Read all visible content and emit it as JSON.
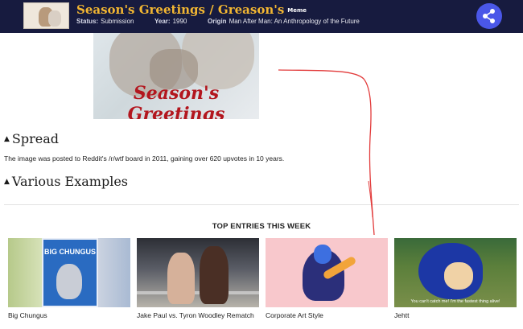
{
  "header": {
    "title": "Season's Greetings / Greason's",
    "badge": "Meme",
    "status_label": "Status:",
    "status_value": "Submission",
    "year_label": "Year:",
    "year_value": "1990",
    "origin_label": "Origin",
    "origin_value": "Man After Man: An Anthropology of the Future",
    "share_icon": "share-icon",
    "colors": {
      "bar": "#171b3f",
      "title": "#f2b632",
      "share": "#4a57e8"
    }
  },
  "hero": {
    "caption": "Season's Greetings"
  },
  "sections": {
    "spread": {
      "heading": "Spread",
      "text": "The image was posted to Reddit's /r/wtf board in 2011, gaining over 620 upvotes in 10 years."
    },
    "examples": {
      "heading": "Various Examples"
    }
  },
  "top_entries": {
    "heading": "TOP ENTRIES THIS WEEK",
    "items": [
      {
        "caption": "Big Chungus",
        "image_text": "BIG CHUNGUS"
      },
      {
        "caption": "Jake Paul vs. Tyron Woodley Rematch"
      },
      {
        "caption": "Corporate Art Style"
      },
      {
        "caption": "Jehtt",
        "image_text": "You can't catch me! I'm the fastest thing alive!"
      }
    ]
  }
}
